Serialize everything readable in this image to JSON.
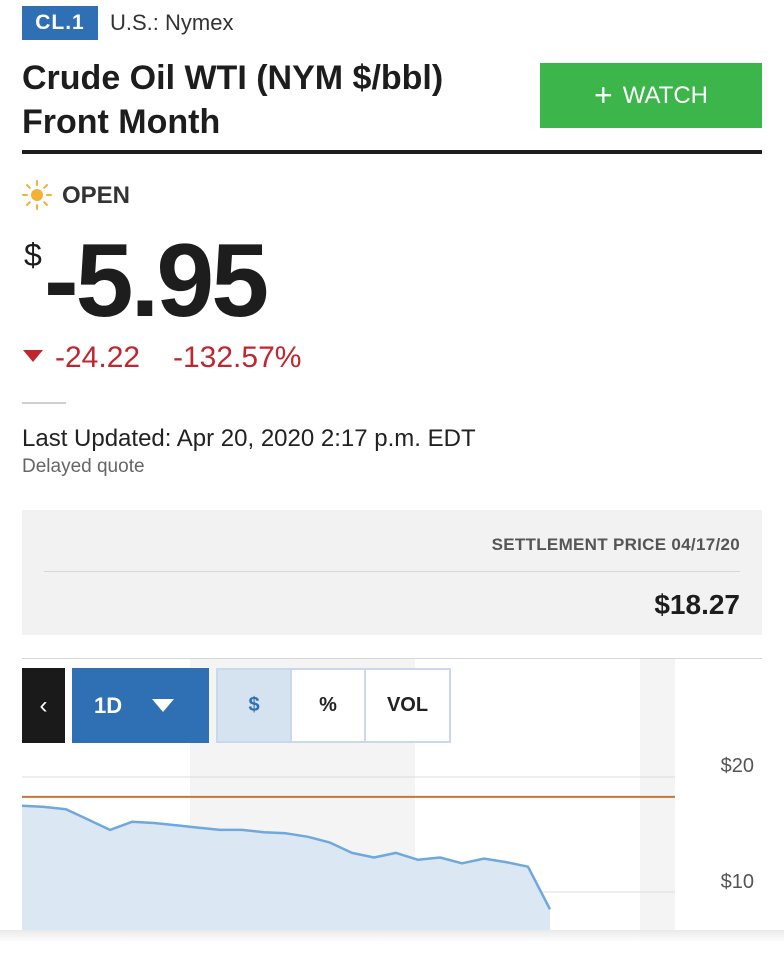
{
  "header": {
    "ticker": "CL.1",
    "exchange": "U.S.: Nymex",
    "title": "Crude Oil WTI (NYM $/bbl) Front Month",
    "watch_label": "WATCH"
  },
  "quote": {
    "status": "OPEN",
    "currency_symbol": "$",
    "price": "-5.95",
    "change": "-24.22",
    "change_percent": "-132.57%",
    "last_updated": "Last Updated: Apr 20, 2020 2:17 p.m. EDT",
    "delay_note": "Delayed quote"
  },
  "settlement": {
    "label": "SETTLEMENT PRICE 04/17/20",
    "value": "$18.27"
  },
  "chart_controls": {
    "back_label": "‹",
    "range": "1D",
    "segments": [
      "$",
      "%",
      "VOL"
    ]
  },
  "colors": {
    "accent_blue": "#2f6fb3",
    "watch_green": "#3cb54a",
    "negative_red": "#c0262d",
    "reference_line": "#c8743a",
    "price_line": "#6fa8dc"
  },
  "chart_data": {
    "type": "area",
    "y_ticks": [
      "$20",
      "$10"
    ],
    "ylim_visible": [
      7.5,
      21
    ],
    "reference_value": 18.27,
    "series": [
      {
        "values": [
          17.5,
          17.4,
          17.2,
          16.3,
          15.4,
          16.1,
          16.0,
          15.8,
          15.6,
          15.4,
          15.4,
          15.2,
          15.1,
          14.8,
          14.3,
          13.4,
          13.0,
          13.4,
          12.8,
          13.0,
          12.5,
          12.9,
          12.6,
          12.2,
          8.5
        ]
      }
    ]
  }
}
